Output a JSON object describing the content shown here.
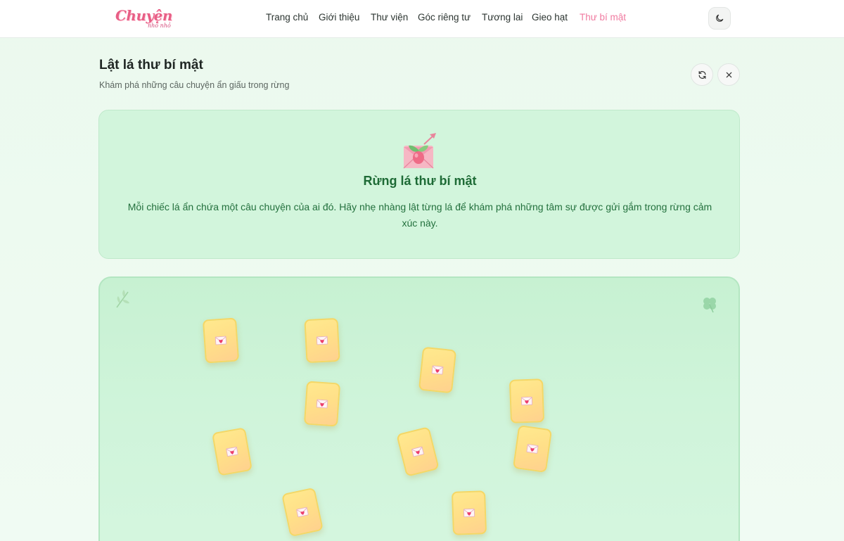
{
  "app": {
    "logo_text": "Chuyện",
    "logo_subtext": "nho nhỏ"
  },
  "nav": {
    "items": [
      {
        "label": "Trang chủ"
      },
      {
        "label": "Giới thiệu"
      },
      {
        "label": "Thư viện"
      },
      {
        "label": "Góc riêng tư"
      },
      {
        "label": "Tương lai"
      },
      {
        "label": "Gieo hạt"
      },
      {
        "label": "Thư bí mật"
      }
    ],
    "active_index": 6,
    "theme_toggle_icon": "moon-icon"
  },
  "page": {
    "title": "Lật lá thư bí mật",
    "subtitle": "Khám phá những câu chuyện ẩn giấu trong rừng",
    "refresh_icon": "refresh-icon",
    "close_icon": "close-icon"
  },
  "intro": {
    "icon": "love-letter-sprout-icon",
    "title": "Rừng lá thư bí mật",
    "text": "Mỗi chiếc lá ẩn chứa một câu chuyện của ai đó. Hãy nhẹ nhàng lật từng lá để khám phá những tâm sự được gửi gắm trong rừng cảm xúc này."
  },
  "forest": {
    "card_icon": "heart-envelope-icon",
    "card_count": 11
  },
  "colors": {
    "accent_pink": "#f07aa0",
    "intro_title_green": "#1e6b36",
    "card_yellow": "#ffe98e",
    "forest_bg": "#c7f1d2"
  }
}
